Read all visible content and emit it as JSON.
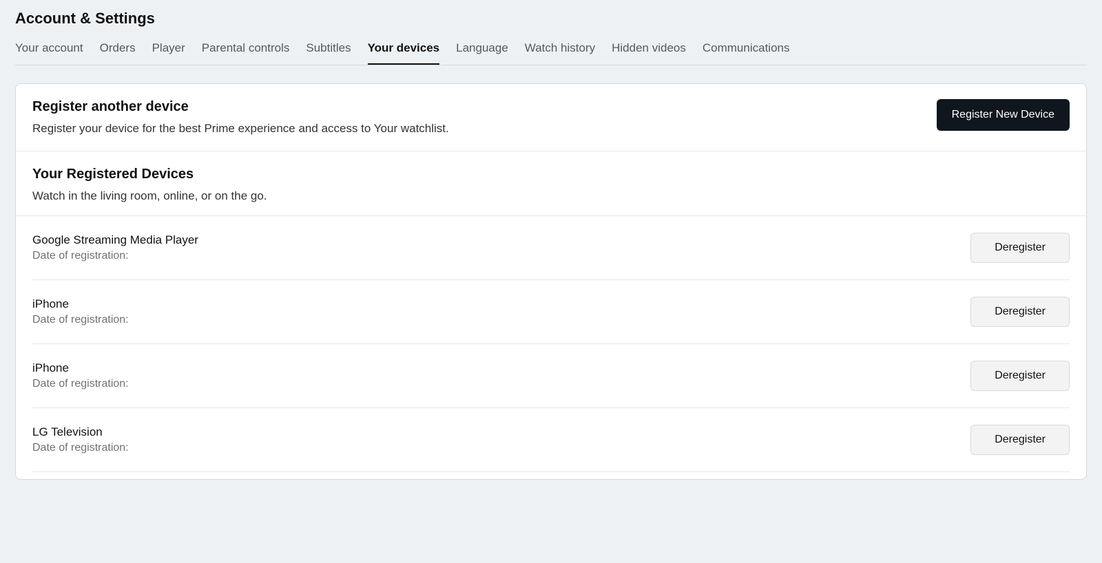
{
  "page_title": "Account & Settings",
  "tabs": [
    {
      "label": "Your account",
      "active": false
    },
    {
      "label": "Orders",
      "active": false
    },
    {
      "label": "Player",
      "active": false
    },
    {
      "label": "Parental controls",
      "active": false
    },
    {
      "label": "Subtitles",
      "active": false
    },
    {
      "label": "Your devices",
      "active": true
    },
    {
      "label": "Language",
      "active": false
    },
    {
      "label": "Watch history",
      "active": false
    },
    {
      "label": "Hidden videos",
      "active": false
    },
    {
      "label": "Communications",
      "active": false
    }
  ],
  "register_section": {
    "title": "Register another device",
    "description": "Register your device for the best Prime experience and access to Your watchlist.",
    "button_label": "Register New Device"
  },
  "registered_section": {
    "title": "Your Registered Devices",
    "description": "Watch in the living room, online, or on the go."
  },
  "date_label_prefix": "Date of registration:",
  "deregister_label": "Deregister",
  "devices": [
    {
      "name": "Google Streaming Media Player"
    },
    {
      "name": "iPhone"
    },
    {
      "name": "iPhone"
    },
    {
      "name": "LG Television"
    }
  ]
}
